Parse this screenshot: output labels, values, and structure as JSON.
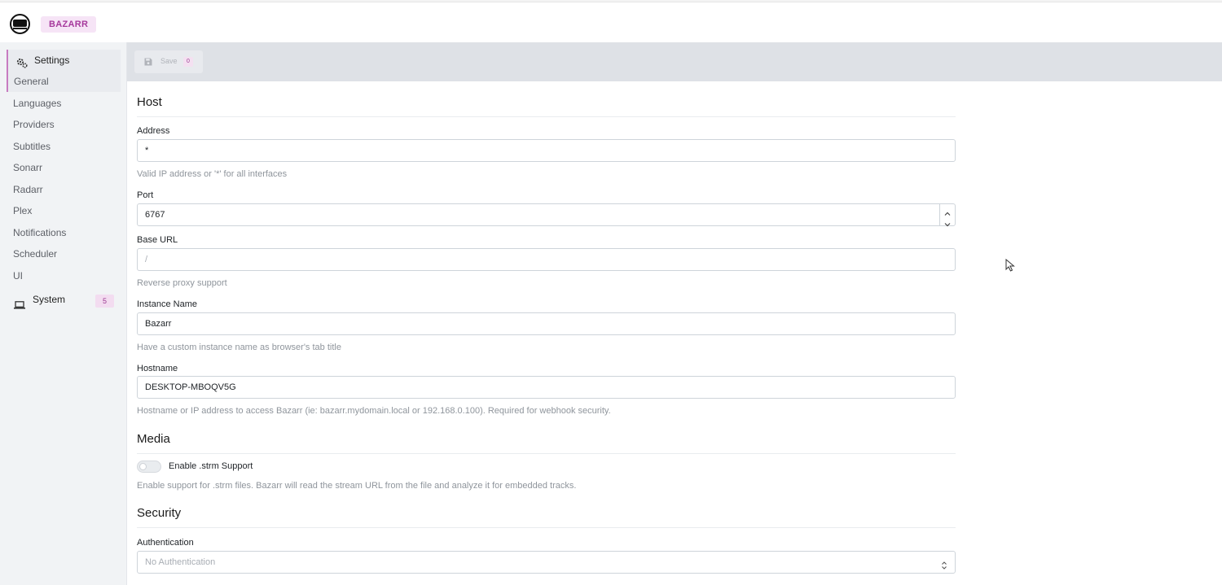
{
  "header": {
    "brand": "BAZARR"
  },
  "sidebar": {
    "settings_label": "Settings",
    "items": [
      {
        "label": "General"
      },
      {
        "label": "Languages"
      },
      {
        "label": "Providers"
      },
      {
        "label": "Subtitles"
      },
      {
        "label": "Sonarr"
      },
      {
        "label": "Radarr"
      },
      {
        "label": "Plex"
      },
      {
        "label": "Notifications"
      },
      {
        "label": "Scheduler"
      },
      {
        "label": "UI"
      }
    ],
    "system_label": "System",
    "system_count": "5"
  },
  "toolbar": {
    "save_label": "Save",
    "save_count": "0"
  },
  "host": {
    "title": "Host",
    "address_label": "Address",
    "address_value": "*",
    "address_hint": "Valid IP address or '*' for all interfaces",
    "port_label": "Port",
    "port_value": "6767",
    "baseurl_label": "Base URL",
    "baseurl_placeholder": "/",
    "baseurl_hint": "Reverse proxy support",
    "instance_label": "Instance Name",
    "instance_value": "Bazarr",
    "instance_hint": "Have a custom instance name as browser's tab title",
    "hostname_label": "Hostname",
    "hostname_value": "DESKTOP-MBOQV5G",
    "hostname_hint": "Hostname or IP address to access Bazarr (ie: bazarr.mydomain.local or 192.168.0.100). Required for webhook security."
  },
  "media": {
    "title": "Media",
    "strm_label": "Enable .strm Support",
    "strm_enabled": false,
    "strm_hint": "Enable support for .strm files. Bazarr will read the stream URL from the file and analyze it for embedded tracks."
  },
  "security": {
    "title": "Security",
    "auth_label": "Authentication",
    "auth_value": "No Authentication"
  }
}
